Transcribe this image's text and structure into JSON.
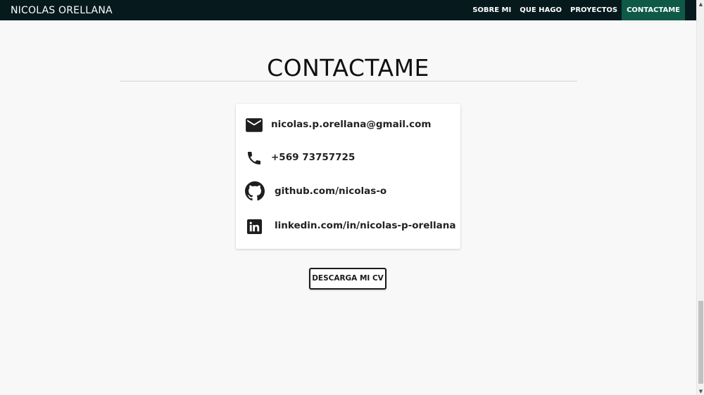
{
  "navbar": {
    "brand": "NICOLAS ORELLANA",
    "links": [
      {
        "label": "SOBRE MI"
      },
      {
        "label": "QUE HAGO"
      },
      {
        "label": "PROYECTOS"
      },
      {
        "label": "CONTACTAME",
        "active": true
      }
    ]
  },
  "main": {
    "title": "CONTACTAME",
    "contacts": [
      {
        "icon": "mail-icon",
        "text": "nicolas.p.orellana@gmail.com"
      },
      {
        "icon": "phone-icon",
        "text": "+569 73757725"
      },
      {
        "icon": "github-icon",
        "text": "github.com/nicolas-o"
      },
      {
        "icon": "linkedin-icon",
        "text": "linkedin.com/in/nicolas-p-orellana"
      }
    ],
    "cv_button": "DESCARGA MI CV"
  },
  "colors": {
    "navbar_bg": "#061a1e",
    "active_nav_bg": "#0e5a47",
    "page_bg": "#f8f8f8",
    "card_bg": "#ffffff"
  }
}
